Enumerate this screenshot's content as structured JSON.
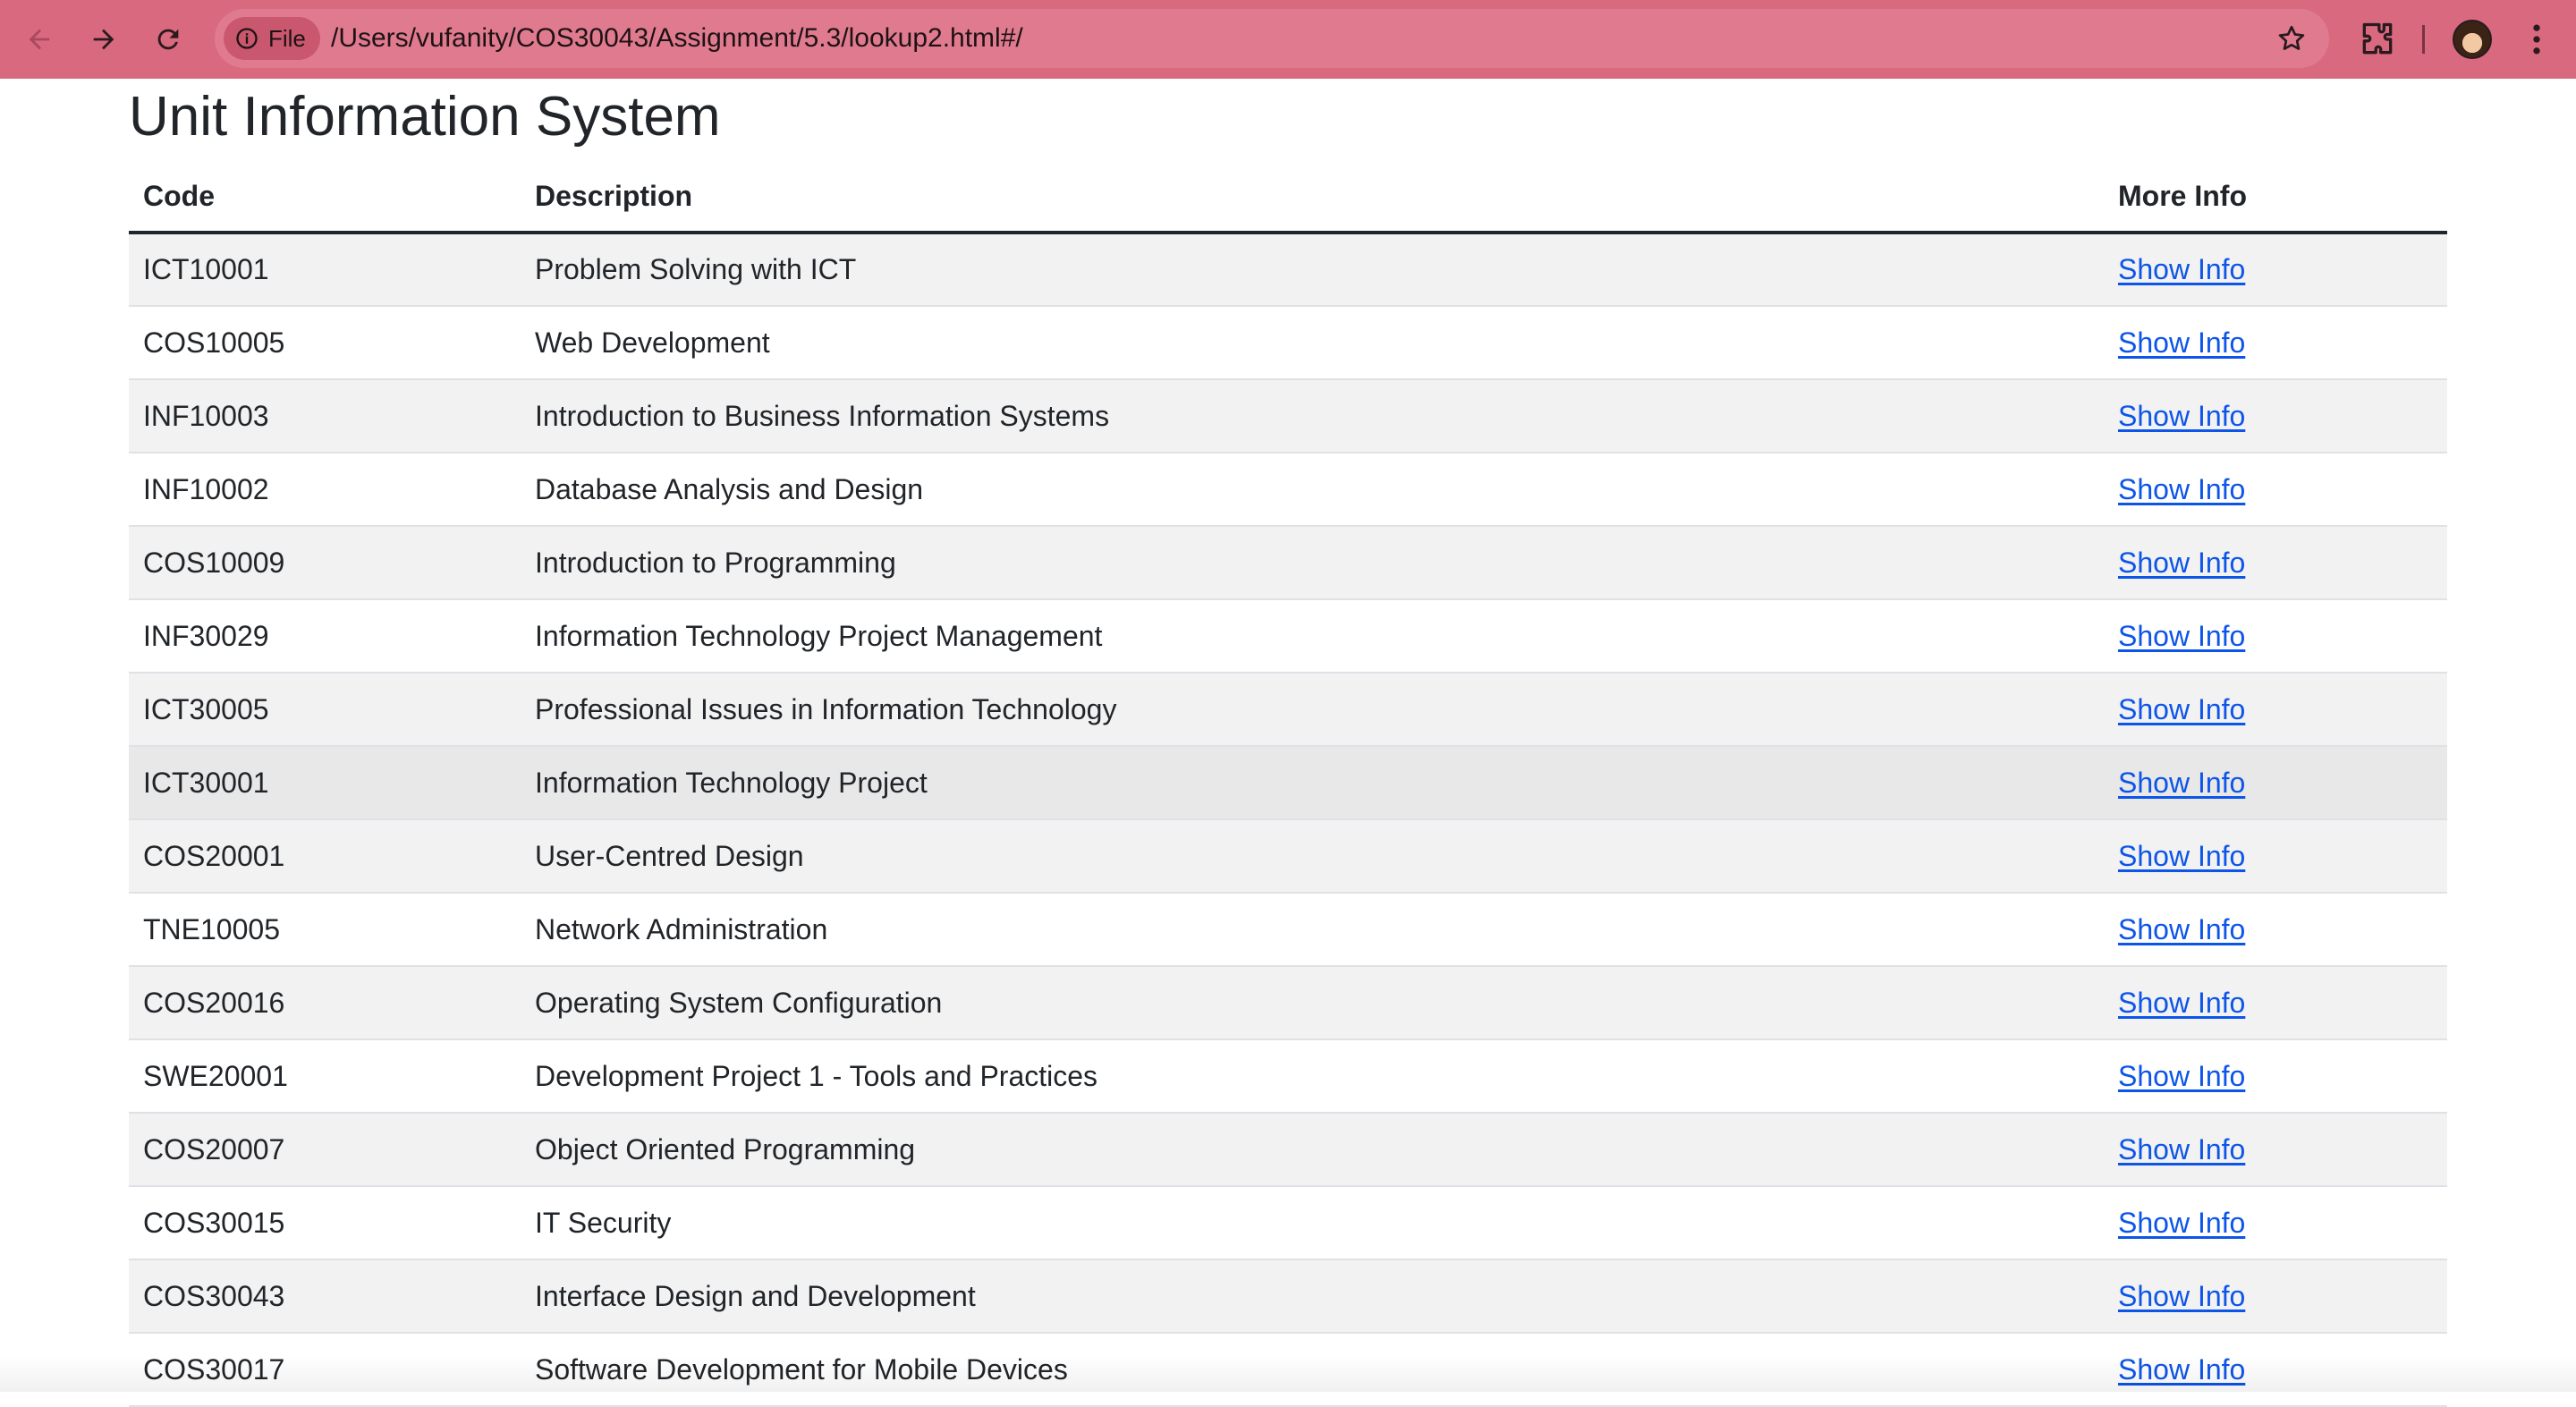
{
  "browser": {
    "scheme_label": "File",
    "url": "/Users/vufanity/COS30043/Assignment/5.3/lookup2.html#/",
    "colors": {
      "toolbar": "#d9697f",
      "omnibox": "#e07b8f"
    }
  },
  "page": {
    "title": "Unit Information System",
    "columns": {
      "code": "Code",
      "description": "Description",
      "more": "More Info"
    },
    "link_color": "#0d55e8",
    "rows": [
      {
        "code": "ICT10001",
        "description": "Problem Solving with ICT",
        "link": "Show Info"
      },
      {
        "code": "COS10005",
        "description": "Web Development",
        "link": "Show Info"
      },
      {
        "code": "INF10003",
        "description": "Introduction to Business Information Systems",
        "link": "Show Info"
      },
      {
        "code": "INF10002",
        "description": "Database Analysis and Design",
        "link": "Show Info"
      },
      {
        "code": "COS10009",
        "description": "Introduction to Programming",
        "link": "Show Info"
      },
      {
        "code": "INF30029",
        "description": "Information Technology Project Management",
        "link": "Show Info"
      },
      {
        "code": "ICT30005",
        "description": "Professional Issues in Information Technology",
        "link": "Show Info"
      },
      {
        "code": "ICT30001",
        "description": "Information Technology Project",
        "link": "Show Info"
      },
      {
        "code": "COS20001",
        "description": "User-Centred Design",
        "link": "Show Info"
      },
      {
        "code": "TNE10005",
        "description": "Network Administration",
        "link": "Show Info"
      },
      {
        "code": "COS20016",
        "description": "Operating System Configuration",
        "link": "Show Info"
      },
      {
        "code": "SWE20001",
        "description": "Development Project 1 - Tools and Practices",
        "link": "Show Info"
      },
      {
        "code": "COS20007",
        "description": "Object Oriented Programming",
        "link": "Show Info"
      },
      {
        "code": "COS30015",
        "description": "IT Security",
        "link": "Show Info"
      },
      {
        "code": "COS30043",
        "description": "Interface Design and Development",
        "link": "Show Info"
      },
      {
        "code": "COS30017",
        "description": "Software Development for Mobile Devices",
        "link": "Show Info"
      }
    ]
  }
}
